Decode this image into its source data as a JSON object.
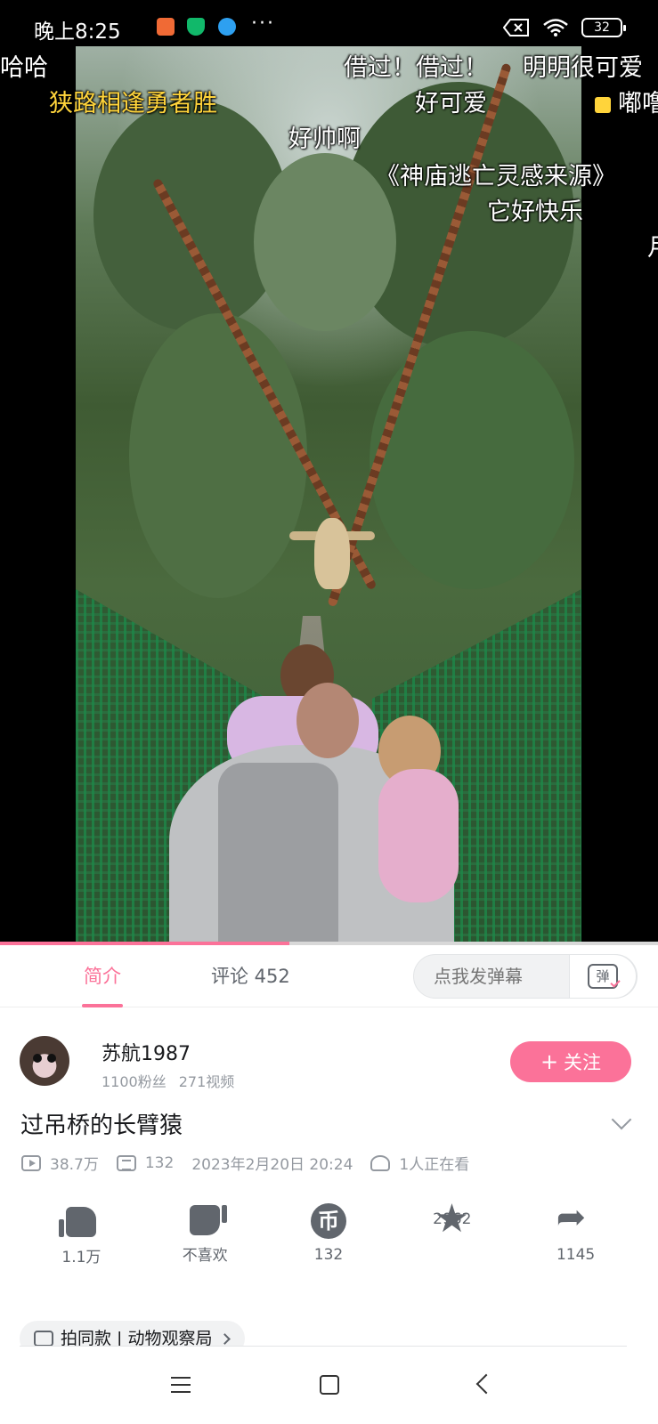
{
  "status_bar": {
    "time": "晚上8:25",
    "more": "···",
    "battery": "32",
    "icons": [
      "moon-icon",
      "shopping-app-icon",
      "security-app-icon",
      "app-icon",
      "no-sim-icon",
      "wifi-icon",
      "battery-icon"
    ]
  },
  "video": {
    "progress_fraction": 0.44,
    "danmaku": [
      {
        "text": "哈哈",
        "color": "#ffffff"
      },
      {
        "text": "狭路相逢勇者胜",
        "color": "#ffd43b"
      },
      {
        "text": "借过！借过！",
        "color": "#ffffff"
      },
      {
        "text": "明明很可爱",
        "color": "#ffffff"
      },
      {
        "text": "好可爱",
        "color": "#ffffff"
      },
      {
        "text": "嘟噜",
        "color": "#ffffff"
      },
      {
        "text": "好帅啊",
        "color": "#ffffff"
      },
      {
        "text": "《神庙逃亡灵感来源》",
        "color": "#ffffff"
      },
      {
        "text": "它好快乐",
        "color": "#ffffff"
      },
      {
        "text": "月",
        "color": "#ffffff"
      }
    ]
  },
  "tabs": {
    "intro": "简介",
    "comments": "评论 452"
  },
  "danmaku_input": {
    "placeholder": "点我发弹幕",
    "switch_label": "弹"
  },
  "uploader": {
    "name": "苏航1987",
    "fans": "1100粉丝",
    "videos": "271视频",
    "follow_plus": "+",
    "follow_label": "关注"
  },
  "video_info": {
    "title": "过吊桥的长臂猿",
    "views": "38.7万",
    "danmaku_count": "132",
    "date": "2023年2月20日 20:24",
    "watching": "1人正在看"
  },
  "actions": {
    "like": "1.1万",
    "dislike": "不喜欢",
    "coin": "132",
    "coin_symbol": "币",
    "favorite": "2962",
    "share": "1145"
  },
  "tag": {
    "label": "拍同款 | 动物观察局"
  },
  "colors": {
    "accent": "#fb7299",
    "text_primary": "#18191c",
    "text_secondary": "#9499a0",
    "danmaku_highlight": "#ffd43b"
  }
}
